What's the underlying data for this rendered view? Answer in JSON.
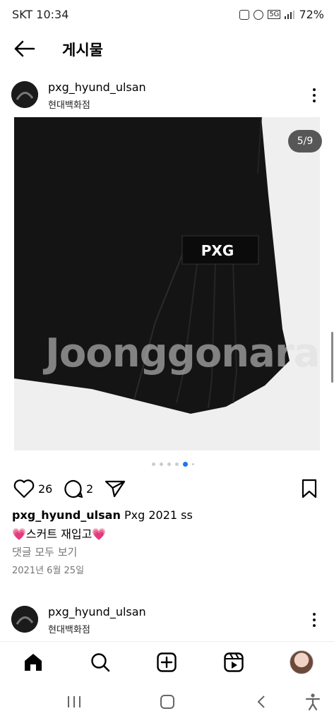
{
  "status": {
    "time": "SKT 10:34",
    "battery": "72%",
    "network": "5G"
  },
  "header": {
    "title": "게시물"
  },
  "post": {
    "username": "pxg_hyund_ulsan",
    "location": "현대백화점",
    "image_counter": "5/9",
    "watermark": "Joonggonara",
    "likes": "26",
    "comments_count": "2",
    "caption_user": "pxg_hyund_ulsan",
    "caption_text": "Pxg 2021 ss",
    "caption_line2": "💗스커트 재입고💗",
    "view_all_comments": "댓글 모두 보기",
    "date": "2021년 6월 25일"
  },
  "next_post": {
    "username": "pxg_hyund_ulsan",
    "location": "현대백화점"
  },
  "nav": {
    "items": [
      "home-icon",
      "search-icon",
      "create-icon",
      "reels-icon",
      "profile-avatar"
    ]
  },
  "colors": {
    "accent": "#1877f2"
  }
}
